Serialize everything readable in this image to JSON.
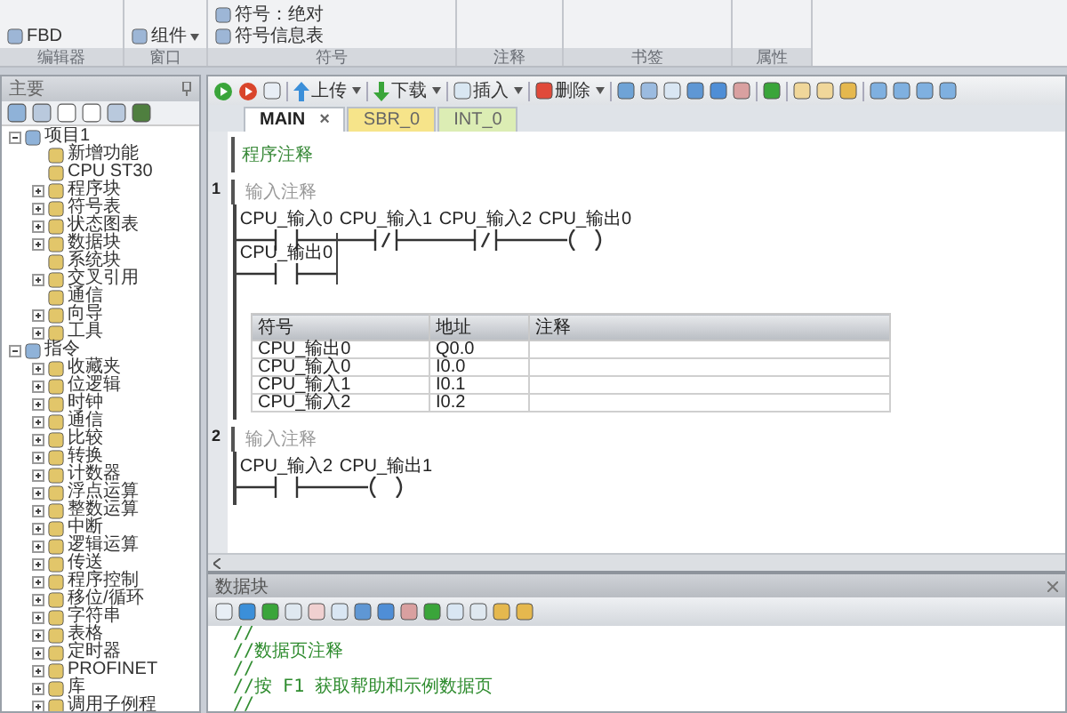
{
  "ribbon": {
    "groups": [
      {
        "label": "编辑器",
        "items": [
          "FBD"
        ]
      },
      {
        "label": "窗口",
        "items": [
          "组件"
        ]
      },
      {
        "label": "符号",
        "items": [
          "符号：绝对",
          "符号信息表"
        ]
      },
      {
        "label": "注释"
      },
      {
        "label": "书签"
      },
      {
        "label": "属性"
      }
    ]
  },
  "sidebar": {
    "title": "主要",
    "tree": [
      {
        "label": "项目1",
        "expanded": true,
        "children": [
          {
            "label": "新增功能"
          },
          {
            "label": "CPU ST30"
          },
          {
            "label": "程序块",
            "expanded": false
          },
          {
            "label": "符号表",
            "expanded": false
          },
          {
            "label": "状态图表",
            "expanded": false
          },
          {
            "label": "数据块",
            "expanded": false
          },
          {
            "label": "系统块"
          },
          {
            "label": "交叉引用",
            "expanded": false
          },
          {
            "label": "通信"
          },
          {
            "label": "向导",
            "expanded": false
          },
          {
            "label": "工具",
            "expanded": false
          }
        ]
      },
      {
        "label": "指令",
        "expanded": true,
        "children": [
          {
            "label": "收藏夹",
            "expanded": false
          },
          {
            "label": "位逻辑",
            "expanded": false
          },
          {
            "label": "时钟",
            "expanded": false
          },
          {
            "label": "通信",
            "expanded": false
          },
          {
            "label": "比较",
            "expanded": false
          },
          {
            "label": "转换",
            "expanded": false
          },
          {
            "label": "计数器",
            "expanded": false
          },
          {
            "label": "浮点运算",
            "expanded": false
          },
          {
            "label": "整数运算",
            "expanded": false
          },
          {
            "label": "中断",
            "expanded": false
          },
          {
            "label": "逻辑运算",
            "expanded": false
          },
          {
            "label": "传送",
            "expanded": false
          },
          {
            "label": "程序控制",
            "expanded": false
          },
          {
            "label": "移位/循环",
            "expanded": false
          },
          {
            "label": "字符串",
            "expanded": false
          },
          {
            "label": "表格",
            "expanded": false
          },
          {
            "label": "定时器",
            "expanded": false
          },
          {
            "label": "PROFINET",
            "expanded": false
          },
          {
            "label": "库",
            "expanded": false
          },
          {
            "label": "调用子例程",
            "expanded": false
          }
        ]
      }
    ]
  },
  "toolbar": {
    "buttons": [
      "上传",
      "下载",
      "插入",
      "删除"
    ]
  },
  "tabs": [
    {
      "label": "MAIN",
      "selected": true,
      "close": "×",
      "color": "#ffffff"
    },
    {
      "label": "SBR_0",
      "selected": false,
      "color": "#f6e48a"
    },
    {
      "label": "INT_0",
      "selected": false,
      "color": "#dcedb4"
    }
  ],
  "program_comment": "程序注释",
  "networks": [
    {
      "number": "1",
      "comment": "输入注释",
      "rung": [
        {
          "kind": "no",
          "label": "CPU_输入0"
        },
        {
          "kind": "nc",
          "label": "CPU_输入1"
        },
        {
          "kind": "nc",
          "label": "CPU_输入2"
        },
        {
          "kind": "coil",
          "label": "CPU_输出0"
        }
      ],
      "branch": [
        {
          "kind": "no",
          "label": "CPU_输出0"
        }
      ],
      "symbol_table": {
        "columns": [
          "符号",
          "地址",
          "注释"
        ],
        "rows": [
          {
            "symbol": "CPU_输出0",
            "address": "Q0.0"
          },
          {
            "symbol": "CPU_输入0",
            "address": "I0.0"
          },
          {
            "symbol": "CPU_输入1",
            "address": "I0.1"
          },
          {
            "symbol": "CPU_输入2",
            "address": "I0.2"
          }
        ]
      }
    },
    {
      "number": "2",
      "comment": "输入注释",
      "rung": [
        {
          "kind": "no",
          "label": "CPU_输入2"
        },
        {
          "kind": "coil",
          "label": "CPU_输出1"
        }
      ]
    }
  ],
  "data_block": {
    "title": "数据块",
    "lines": [
      "//",
      "//数据页注释",
      "//",
      "//按 F1 获取帮助和示例数据页",
      "//"
    ]
  }
}
